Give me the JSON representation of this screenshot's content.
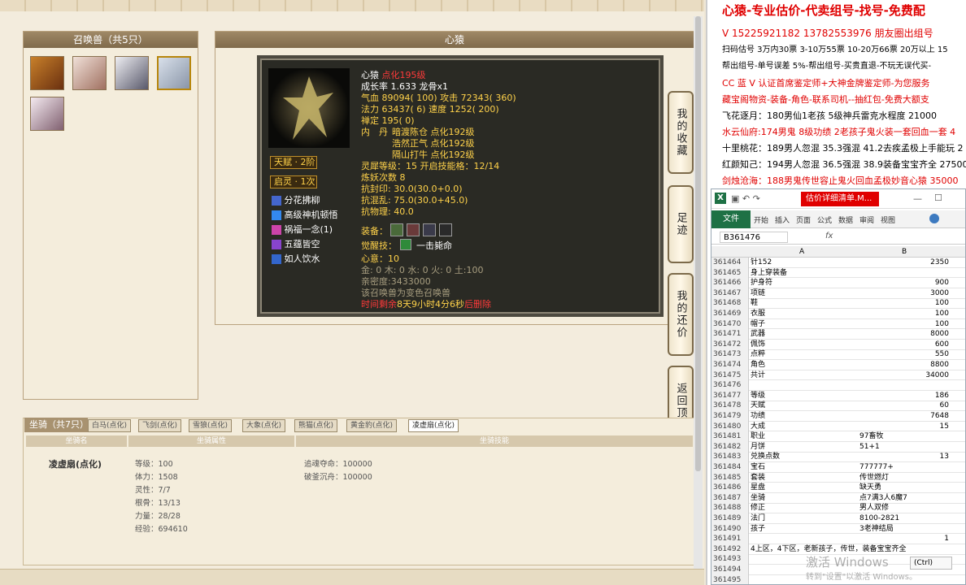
{
  "game": {
    "summon_panel_title": "召唤兽（共5只）",
    "pet_panel_title": "心猿",
    "pet": {
      "name": "心猿",
      "name_tag": "点化195级",
      "growth": "成长率 1.633 龙骨x1",
      "hp": "气血 89094( 100)",
      "atk": "攻击 72343( 360)",
      "mp": "法力 63437( 6)",
      "spd": "速度 1252( 200)",
      "zen": "禅定 195( 0)",
      "dan_label": "内　丹",
      "dans": [
        "暗渡陈仓 点化192级",
        "浩然正气 点化192级",
        "隔山打牛 点化192级"
      ],
      "talent": "天赋 · 2阶",
      "soul": "启灵 · 1次",
      "skills": [
        "分花拂柳",
        "高级神机顿悟",
        "祸福一念(1)",
        "五蕴皆空",
        "如人饮水"
      ],
      "spirit": "灵犀等级：15 开启技能格：12/14",
      "refine": "炼妖次数 8",
      "res1": "抗封印: 30.0(30.0+0.0)",
      "res2": "抗混乱: 75.0(30.0+45.0)",
      "res3": "抗物理: 40.0",
      "equip_label": "装备：",
      "awaken_label": "觉醒技：",
      "awaken_skill": "一击毙命",
      "heart": "心意：10",
      "elements": "金: 0 木: 0 水: 0 火: 0 土:100",
      "intimacy": "亲密度:3433000",
      "morph": "该召唤兽为变色召唤兽",
      "expire_prefix": "时间剩余",
      "expire_time": "8天9小时4分6秒",
      "expire_suffix": "后删除"
    },
    "side_buttons": [
      "我的收藏",
      "足迹",
      "我的还价",
      "返回顶部"
    ],
    "mount": {
      "title": "坐骑（共7只）",
      "tabs": [
        "白马(点化)",
        "飞剑(点化)",
        "雪狼(点化)",
        "大象(点化)",
        "熊猫(点化)",
        "黄金豹(点化)",
        "凌虚扇(点化)"
      ],
      "columns": [
        "坐骑名",
        "坐骑属性",
        "坐骑技能"
      ],
      "name": "凌虚扇(点化)",
      "attrs": [
        "等级：100",
        "体力：1508",
        "灵性：7/7",
        "根骨：13/13",
        "力量：28/28",
        "经验：694610"
      ],
      "skills": [
        "追魂夺命：100000",
        "破釜沉舟：100000"
      ]
    }
  },
  "ad": {
    "title": "心猿-专业估价-代卖组号-找号-免费配",
    "lines": [
      "V 15225921182   13782553976 朋友圈出组号",
      "扫码估号 3万内30票 3-10万55票 10-20万66票 20万以上 15",
      "帮出组号-单号误差 5%-帮出组号-买贵直退-不玩无误代买-",
      "CC 蓝 V 认证首席鉴定师+大神金牌鉴定师-为您服务",
      "藏宝阁物资-装备-角色-联系司机--抽红包-免费大额支",
      "飞花逐月：180男仙1老孩 5级神兵雷克水程度 21000",
      "水云仙府:174男鬼 8级功绩 2老孩子鬼火装一套回血一套 4",
      "十里桃花：189男人忽混 35.3强混 41.2去疾孟极上手能玩 2",
      "红颜知己：194男人忽混 36.5强混 38.9装备宝宝齐全 27500",
      "剑烛沧海：188男鬼传世容止鬼火回血孟极妙音心猿 35000"
    ]
  },
  "excel": {
    "title": "估价详细清单.M...",
    "ribbon_tabs": [
      "文件",
      "开始",
      "插入",
      "页面",
      "公式",
      "数据",
      "审阅",
      "视图"
    ],
    "name_box": "B361476",
    "fx": "fx",
    "col_a": "A",
    "col_b": "B",
    "rows": [
      [
        "361464",
        "针152",
        "2350"
      ],
      [
        "361465",
        "身上穿装备",
        ""
      ],
      [
        "361466",
        "护身符",
        "900"
      ],
      [
        "361467",
        "项链",
        "3000"
      ],
      [
        "361468",
        "鞋",
        "100"
      ],
      [
        "361469",
        "衣服",
        "100"
      ],
      [
        "361470",
        "帽子",
        "100"
      ],
      [
        "361471",
        "武器",
        "8000"
      ],
      [
        "361472",
        "佩饰",
        "600"
      ],
      [
        "361473",
        "点粹",
        "550"
      ],
      [
        "361474",
        "角色",
        "8800"
      ],
      [
        "361475",
        "共计",
        "34000"
      ],
      [
        "361476",
        "",
        ""
      ],
      [
        "361477",
        "等级",
        "186"
      ],
      [
        "361478",
        "天赋",
        "60"
      ],
      [
        "361479",
        "功绩",
        "7648"
      ],
      [
        "361480",
        "大成",
        "15"
      ],
      [
        "361481",
        "职业",
        "97畜牧"
      ],
      [
        "361482",
        "月饼",
        "51+1"
      ],
      [
        "361483",
        "兑换点数",
        "13"
      ],
      [
        "361484",
        "宝石",
        "777777+"
      ],
      [
        "361485",
        "套装",
        "传世燃灯"
      ],
      [
        "361486",
        "星盘",
        "缺天勇"
      ],
      [
        "361487",
        "坐骑",
        "点7满3人6魔7"
      ],
      [
        "361488",
        "修正",
        "男人双修"
      ],
      [
        "361489",
        "法门",
        "8100-2821"
      ],
      [
        "361490",
        "孩子",
        "3老神结局"
      ],
      [
        "361491",
        "",
        "1"
      ],
      [
        "361492",
        "4上区，4下区，老新孩子，传世，装备宝宝齐全",
        ""
      ],
      [
        "361493",
        "",
        ""
      ],
      [
        "361494",
        "",
        ""
      ],
      [
        "361495",
        "",
        ""
      ]
    ],
    "watermark1": "激活 Windows",
    "watermark2": "转到\"设置\"以激活 Windows。",
    "ctrl": "(Ctrl)"
  }
}
